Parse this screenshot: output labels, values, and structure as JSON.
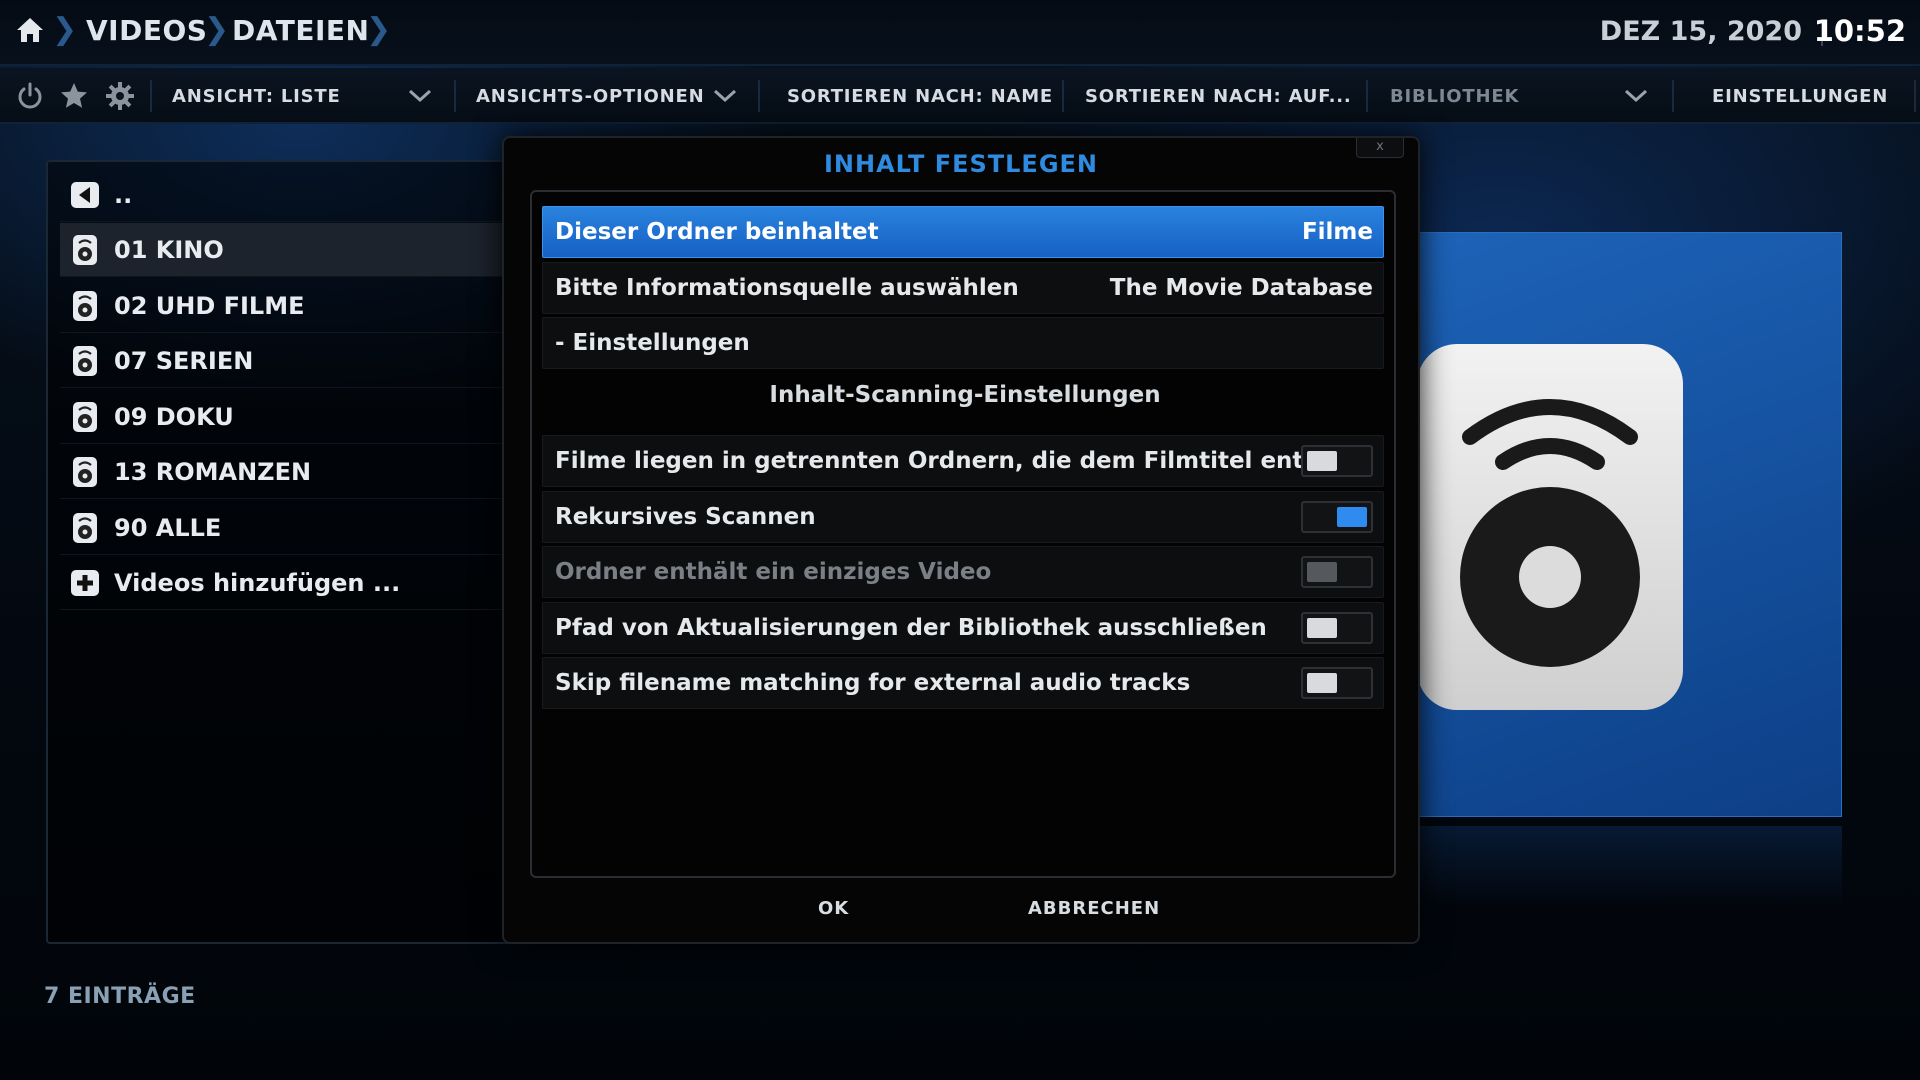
{
  "header": {
    "home_icon": "home-icon",
    "breadcrumbs": [
      "VIDEOS",
      "DATEIEN"
    ],
    "date": "DEZ 15, 2020",
    "time": "10:52"
  },
  "toolbar": {
    "icons": [
      "power-icon",
      "star-icon",
      "gear-icon"
    ],
    "view_label": "ANSICHT: LISTE",
    "view_options_label": "ANSICHTS-OPTIONEN",
    "sort_by_label": "SORTIEREN NACH: NAME",
    "sort_order_label": "SORTIEREN NACH: AUF...",
    "library_label": "BIBLIOTHEK",
    "settings_label": "EINSTELLUNGEN"
  },
  "file_list": {
    "parent_label": "..",
    "items": [
      {
        "label": "01 KINO",
        "icon": "speaker-icon",
        "focused": true
      },
      {
        "label": "02 UHD FILME",
        "icon": "speaker-icon"
      },
      {
        "label": "07 SERIEN",
        "icon": "speaker-icon"
      },
      {
        "label": "09 DOKU",
        "icon": "speaker-icon"
      },
      {
        "label": "13 ROMANZEN",
        "icon": "speaker-icon"
      },
      {
        "label": "90 ALLE",
        "icon": "speaker-icon"
      }
    ],
    "add_label": "Videos hinzufügen ..."
  },
  "status": {
    "entries_count": "7 EINTRÄGE"
  },
  "dialog": {
    "title": "INHALT FESTLEGEN",
    "close_label": "x",
    "content_type": {
      "label": "Dieser Ordner beinhaltet",
      "value": "Filme"
    },
    "info_source": {
      "label": "Bitte Informationsquelle auswählen",
      "value": "The Movie Database"
    },
    "settings_label": "- Einstellungen",
    "scan_section_title": "Inhalt-Scanning-Einstellungen",
    "toggles": [
      {
        "label": "Filme liegen in getrennten Ordnern, die dem Filmtitel entsp...",
        "state": "off"
      },
      {
        "label": "Rekursives Scannen",
        "state": "on"
      },
      {
        "label": "Ordner enthält ein einziges Video",
        "state": "disabled"
      },
      {
        "label": "Pfad von Aktualisierungen der Bibliothek ausschließen",
        "state": "off"
      },
      {
        "label": "Skip filename matching for external audio tracks",
        "state": "off"
      }
    ],
    "ok_label": "OK",
    "cancel_label": "ABBRECHEN"
  },
  "colors": {
    "accent": "#2f8be0",
    "focus_row": "#1e6fd0",
    "preview_bg": "#1d63b8"
  }
}
